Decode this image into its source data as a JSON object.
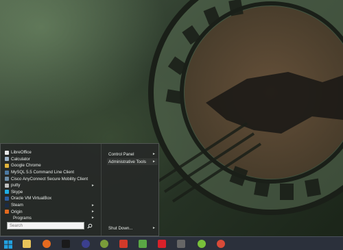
{
  "start_menu": {
    "programs": [
      {
        "label": "LibreOffice",
        "icon": "libreoffice-icon",
        "color": "#e8e8e8",
        "has_submenu": false
      },
      {
        "label": "Calculator",
        "icon": "calculator-icon",
        "color": "#9db3c8",
        "has_submenu": false
      },
      {
        "label": "Google Chrome",
        "icon": "chrome-icon",
        "color": "#e0b33a",
        "has_submenu": false
      },
      {
        "label": "MySQL 5.5 Command Line Client",
        "icon": "mysql-icon",
        "color": "#4c7aa3",
        "has_submenu": false
      },
      {
        "label": "Cisco AnyConnect Secure Mobility Client",
        "icon": "cisco-icon",
        "color": "#6d8ea8",
        "has_submenu": false
      },
      {
        "label": "putty",
        "icon": "putty-icon",
        "color": "#c0c0c0",
        "has_submenu": true
      },
      {
        "label": "Skype",
        "icon": "skype-icon",
        "color": "#1eaee5",
        "has_submenu": false
      },
      {
        "label": "Oracle VM VirtualBox",
        "icon": "virtualbox-icon",
        "color": "#2b5ea3",
        "has_submenu": false
      },
      {
        "label": "Steam",
        "icon": "steam-icon",
        "color": "#1a2b44",
        "has_submenu": true
      },
      {
        "label": "Origin",
        "icon": "origin-icon",
        "color": "#e36a1e",
        "has_submenu": true
      }
    ],
    "programs_label": "Programs",
    "search_placeholder": "Search",
    "right_items": {
      "control_panel": "Control Panel",
      "admin_tools": "Administrative Tools",
      "shut_down": "Shut Down..."
    }
  },
  "taskbar": {
    "items": [
      {
        "name": "start-button",
        "icon": "windows-logo-icon",
        "color": "#21a1e1"
      },
      {
        "name": "file-explorer-button",
        "icon": "folder-icon",
        "color": "#e8c45a"
      },
      {
        "name": "firefox-button",
        "icon": "firefox-icon",
        "color": "#e66a1f"
      },
      {
        "name": "cmd-button",
        "icon": "terminal-icon",
        "color": "#1a1a1a"
      },
      {
        "name": "eclipse-button",
        "icon": "eclipse-icon",
        "color": "#3b3f8e"
      },
      {
        "name": "gimp-button",
        "icon": "gimp-icon",
        "color": "#7a9c3a"
      },
      {
        "name": "app-red-button",
        "icon": "red-app-icon",
        "color": "#d23a2a"
      },
      {
        "name": "image-viewer-button",
        "icon": "image-icon",
        "color": "#5aa845"
      },
      {
        "name": "xmind-button",
        "icon": "mindmap-icon",
        "color": "#d8212a"
      },
      {
        "name": "controller-button",
        "icon": "gamepad-icon",
        "color": "#666666"
      },
      {
        "name": "utorrent-button",
        "icon": "utorrent-icon",
        "color": "#78c03a"
      },
      {
        "name": "chrome-button",
        "icon": "chrome-icon",
        "color": "#d84a38"
      }
    ]
  }
}
